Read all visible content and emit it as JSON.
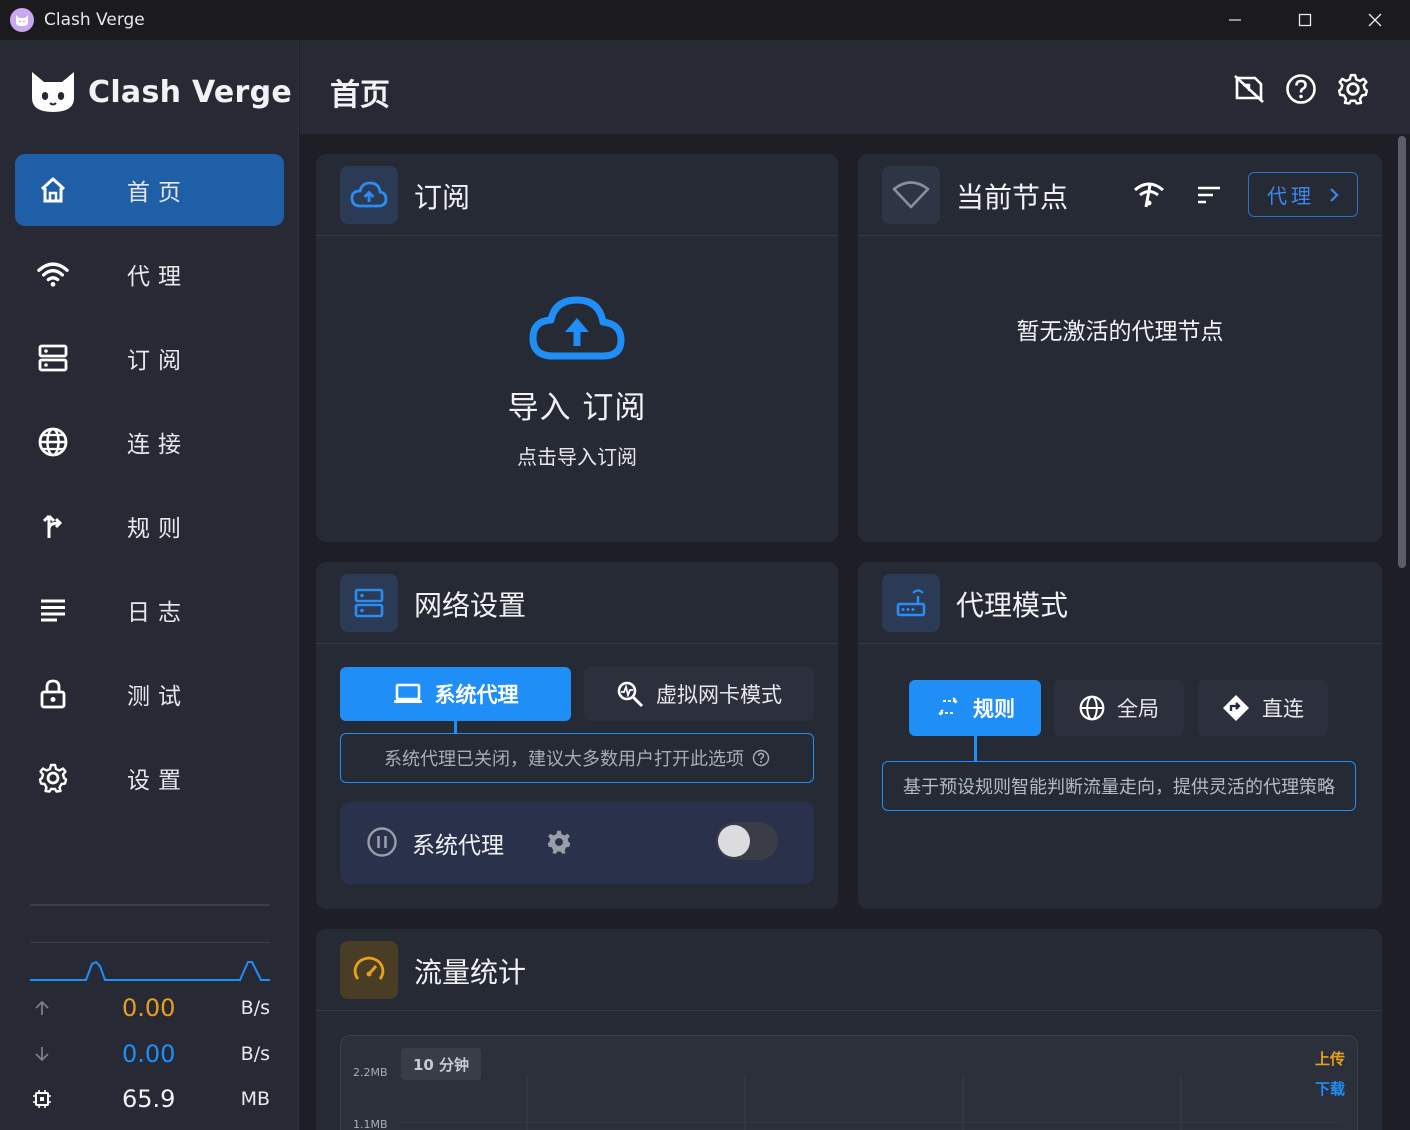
{
  "window": {
    "title": "Clash Verge"
  },
  "app": {
    "logo_text": "Clash Verge"
  },
  "nav": [
    {
      "label": "首页",
      "icon": "home-icon",
      "active": true
    },
    {
      "label": "代理",
      "icon": "wifi-icon",
      "active": false
    },
    {
      "label": "订阅",
      "icon": "server-icon",
      "active": false
    },
    {
      "label": "连接",
      "icon": "globe-icon",
      "active": false
    },
    {
      "label": "规则",
      "icon": "fork-icon",
      "active": false
    },
    {
      "label": "日志",
      "icon": "list-icon",
      "active": false
    },
    {
      "label": "测试",
      "icon": "lock-icon",
      "active": false
    },
    {
      "label": "设置",
      "icon": "gear-icon",
      "active": false
    }
  ],
  "stats": {
    "upload": {
      "value": "0.00",
      "unit": "B/s"
    },
    "download": {
      "value": "0.00",
      "unit": "B/s"
    },
    "memory": {
      "value": "65.9",
      "unit": "MB"
    }
  },
  "header": {
    "title": "首页"
  },
  "subscription": {
    "title": "订阅",
    "import_title": "导入 订阅",
    "import_sub": "点击导入订阅"
  },
  "current_node": {
    "title": "当前节点",
    "proxy_link": "代理",
    "empty": "暂无激活的代理节点"
  },
  "network": {
    "title": "网络设置",
    "tab_system": "系统代理",
    "tab_tun": "虚拟网卡模式",
    "hint": "系统代理已关闭，建议大多数用户打开此选项",
    "row_label": "系统代理",
    "enabled": false
  },
  "proxy_mode": {
    "title": "代理模式",
    "rule": "规则",
    "global": "全局",
    "direct": "直连",
    "hint": "基于预设规则智能判断流量走向，提供灵活的代理策略"
  },
  "traffic": {
    "title": "流量统计",
    "range": "10 分钟",
    "y_max": "2.2MB",
    "y_mid": "1.1MB",
    "legend_upload": "上传",
    "legend_download": "下载"
  },
  "colors": {
    "accent": "#1f8ef7",
    "upload": "#e6a01c",
    "download": "#1f8ef7",
    "active_nav": "#1f5fa8"
  }
}
